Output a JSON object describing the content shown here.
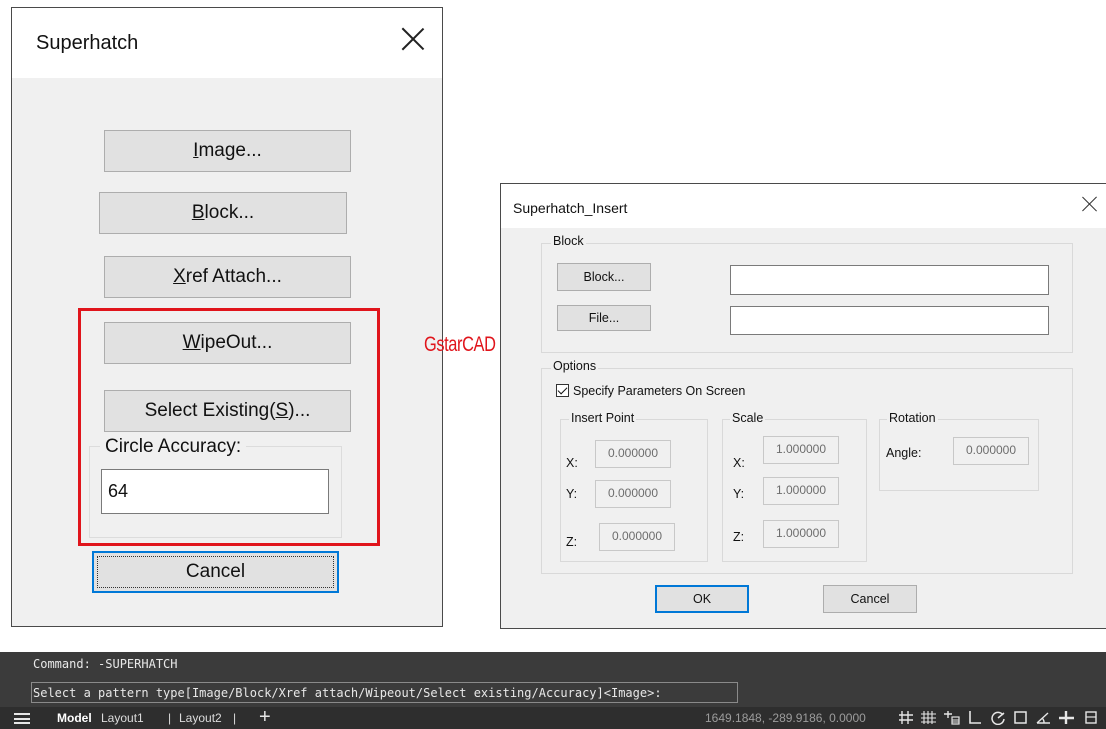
{
  "superhatch": {
    "title": "Superhatch",
    "buttons": {
      "image": {
        "mnemonic": "I",
        "rest": "mage..."
      },
      "block": {
        "mnemonic": "B",
        "rest": "lock..."
      },
      "xref": {
        "mnemonic": "X",
        "rest": "ref Attach..."
      },
      "wipeout": {
        "mnemonic": "W",
        "rest": "ipeOut..."
      },
      "select_existing": {
        "pre": "Select Existing(",
        "mnemonic": "S",
        "post": ")..."
      }
    },
    "circle_accuracy_label": "Circle Accuracy:",
    "circle_accuracy_value": "64",
    "cancel": "Cancel"
  },
  "watermark": "GstarCAD",
  "insert_dialog": {
    "title": "Superhatch_Insert",
    "block_group": "Block",
    "block_button": "Block...",
    "file_button": "File...",
    "block_name_value": "",
    "file_path_value": "",
    "options_group": "Options",
    "specify_on_screen": "Specify Parameters On Screen",
    "specify_checked": true,
    "insert_point": {
      "label": "Insert Point",
      "x_label": "X:",
      "x": "0.000000",
      "y_label": "Y:",
      "y": "0.000000",
      "z_label": "Z:",
      "z": "0.000000"
    },
    "scale": {
      "label": "Scale",
      "x_label": "X:",
      "x": "1.000000",
      "y_label": "Y:",
      "y": "1.000000",
      "z_label": "Z:",
      "z": "1.000000"
    },
    "rotation": {
      "label": "Rotation",
      "angle_label": "Angle:",
      "angle": "0.000000"
    },
    "ok": "OK",
    "cancel": "Cancel"
  },
  "command_line": {
    "history": "Command: -SUPERHATCH",
    "prompt": "Select a pattern type[Image/Block/Xref attach/Wipeout/Select existing/Accuracy]<Image>:"
  },
  "status_bar": {
    "model": "Model",
    "layout1": "Layout1",
    "separator": "|",
    "layout2": "Layout2",
    "add_tab": "+",
    "coordinates": "1649.1848, -289.9186, 0.0000",
    "icons": [
      "grid-display-icon",
      "snap-mode-icon",
      "infer-constraints-icon",
      "ortho-mode-icon",
      "polar-tracking-icon",
      "object-snap-icon",
      "dynamic-ucs-icon",
      "lineweight-icon",
      "more-icon"
    ]
  }
}
